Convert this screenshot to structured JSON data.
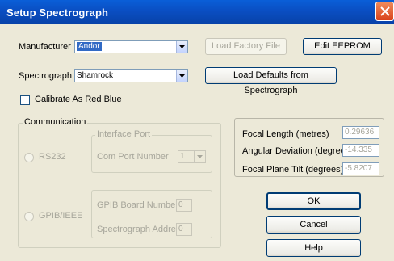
{
  "window": {
    "title": "Setup Spectrograph"
  },
  "manufacturer": {
    "label": "Manufacturer",
    "value": "Andor"
  },
  "spectrograph": {
    "label": "Spectrograph",
    "value": "Shamrock"
  },
  "buttons": {
    "load_factory": "Load Factory File",
    "edit_eeprom": "Edit EEPROM",
    "load_defaults": "Load Defaults from Spectrograph",
    "ok": "OK",
    "cancel": "Cancel",
    "help": "Help"
  },
  "calibrate": {
    "label": "Calibrate As Red Blue",
    "checked": false
  },
  "communication": {
    "title": "Communication",
    "rs232_label": "RS232",
    "interface_port": {
      "title": "Interface Port",
      "com_port_label": "Com Port Number",
      "com_port_value": "1"
    },
    "gpib_label": "GPIB/IEEE",
    "gpib_board_label": "GPIB Board Number",
    "gpib_board_value": "0",
    "spectrograph_address_label": "Spectrograph Address",
    "spectrograph_address_value": "0"
  },
  "info": {
    "focal_length_label": "Focal Length (metres)",
    "focal_length_value": "0.29636",
    "angular_deviation_label": "Angular Deviation (degrees)",
    "angular_deviation_value": "-14.335",
    "focal_plane_tilt_label": "Focal Plane Tilt (degrees)",
    "focal_plane_tilt_value": "-5.8207"
  }
}
